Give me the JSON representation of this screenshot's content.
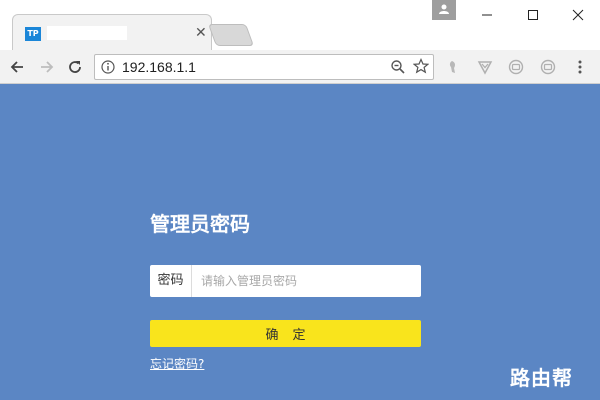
{
  "browser": {
    "tab_favicon": "TP",
    "address": "192.168.1.1",
    "icons": [
      "back-icon",
      "forward-icon",
      "reload-icon",
      "info-icon",
      "zoom-icon",
      "star-icon",
      "extension-icon",
      "adblock-icon",
      "extension-icon",
      "extension-icon",
      "menu-icon"
    ]
  },
  "login": {
    "title": "管理员密码",
    "password_label": "密码",
    "password_placeholder": "请输入管理员密码",
    "password_value": "",
    "confirm_label": "确定",
    "forgot_link": "忘记密码?"
  },
  "watermark": "路由帮",
  "colors": {
    "page_background": "#5b86c4",
    "confirm_button": "#f9e41c"
  }
}
